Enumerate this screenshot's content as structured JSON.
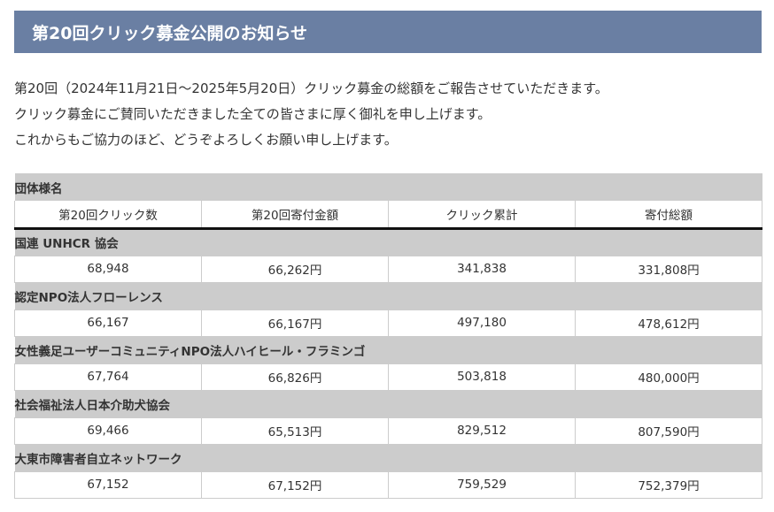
{
  "page": {
    "title": "第20回クリック募金公開のお知らせ",
    "intro": [
      "第20回（2024年11月21日～2025年5月20日）クリック募金の総額をご報告させていただきます。",
      "クリック募金にご賛同いただきました全ての皆さまに厚く御礼を申し上げます。",
      "これからもご協力のほど、どうぞよろしくお願い申し上げます。"
    ]
  },
  "table": {
    "org_header": "団体様名",
    "columns": [
      "第20回クリック数",
      "第20回寄付金額",
      "クリック累計",
      "寄付総額"
    ],
    "rows": [
      {
        "org": "国連 UNHCR 協会",
        "values": [
          "68,948",
          "66,262円",
          "341,838",
          "331,808円"
        ]
      },
      {
        "org": "認定NPO法人フローレンス",
        "values": [
          "66,167",
          "66,167円",
          "497,180",
          "478,612円"
        ]
      },
      {
        "org": "女性義足ユーザーコミュニティNPO法人ハイヒール・フラミンゴ",
        "values": [
          "67,764",
          "66,826円",
          "503,818",
          "480,000円"
        ]
      },
      {
        "org": "社会福祉法人日本介助犬協会",
        "values": [
          "69,466",
          "65,513円",
          "829,512",
          "807,590円"
        ]
      },
      {
        "org": "大東市障害者自立ネットワーク",
        "values": [
          "67,152",
          "67,152円",
          "759,529",
          "752,379円"
        ]
      }
    ]
  },
  "colors": {
    "title_bar": "#6a7fa3",
    "row_header_bg": "#cccccc",
    "text": "#333333"
  }
}
